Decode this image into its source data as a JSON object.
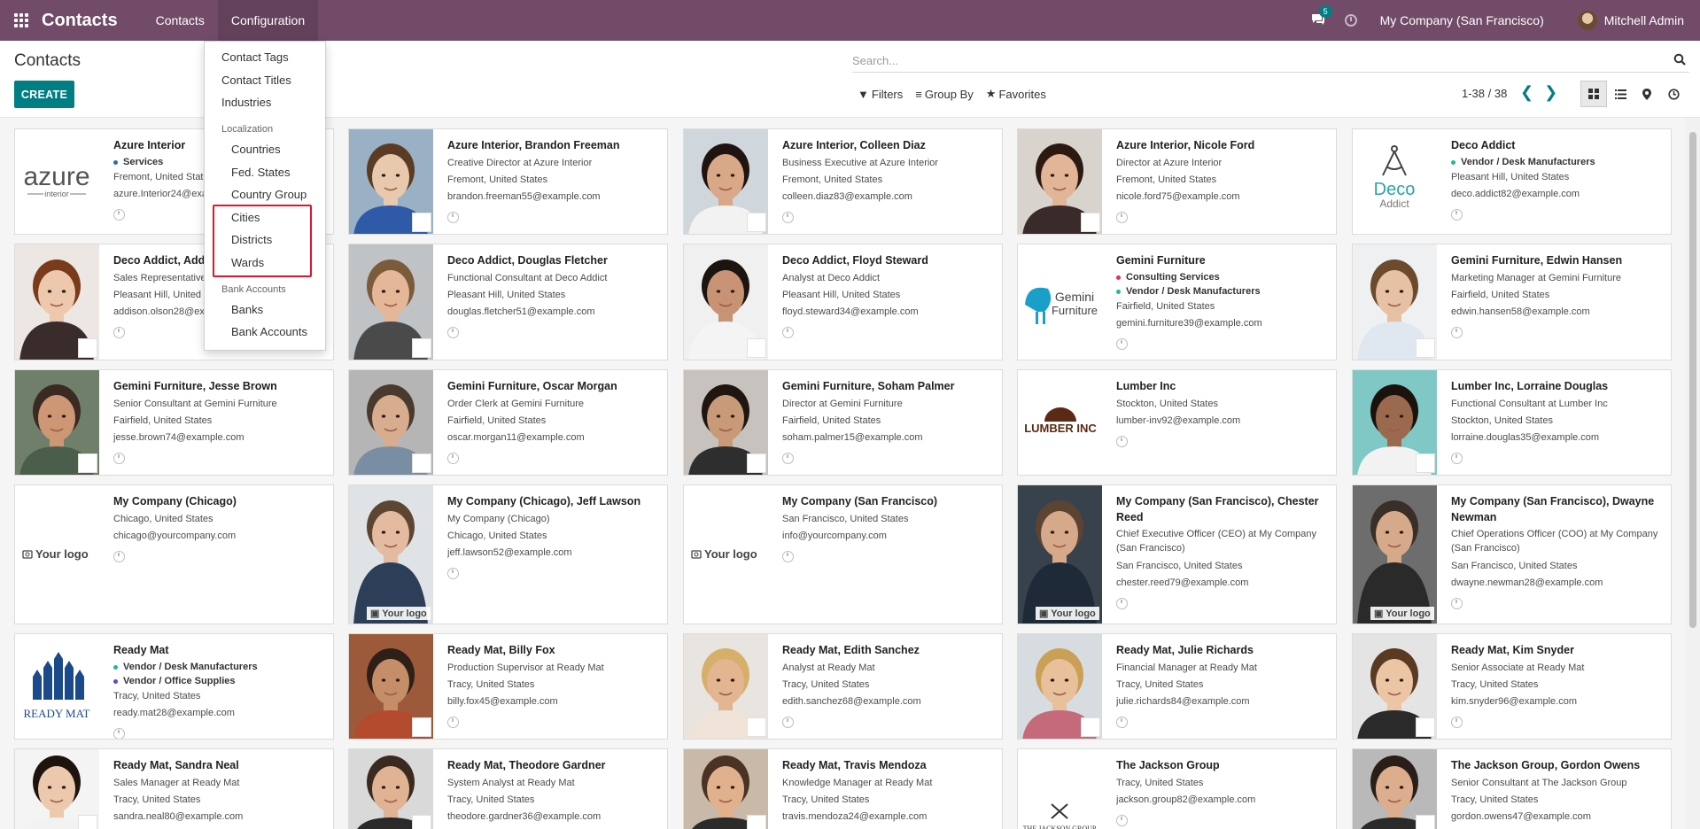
{
  "navbar": {
    "app_name": "Contacts",
    "menu": [
      "Contacts",
      "Configuration"
    ],
    "chat_count": "5",
    "company": "My Company (San Francisco)",
    "user": "Mitchell Admin"
  },
  "control_panel": {
    "title": "Contacts",
    "create_label": "CREATE",
    "search_placeholder": "Search...",
    "filters_label": "Filters",
    "groupby_label": "Group By",
    "favorites_label": "Favorites",
    "pager": "1-38 / 38"
  },
  "dropdown": {
    "items_top": [
      "Contact Tags",
      "Contact Titles",
      "Industries"
    ],
    "localization_header": "Localization",
    "localization_items": [
      "Countries",
      "Fed. States",
      "Country Group",
      "Cities",
      "Districts",
      "Wards"
    ],
    "bank_header": "Bank Accounts",
    "bank_items": [
      "Banks",
      "Bank Accounts"
    ]
  },
  "cards": [
    {
      "name": "Azure Interior",
      "tags": [
        {
          "label": "Services",
          "color": "#2b6cb0"
        }
      ],
      "lines": [
        "Fremont, United States",
        "azure.Interior24@example.com"
      ],
      "img": "azure"
    },
    {
      "name": "Azure Interior, Brandon Freeman",
      "lines": [
        "Creative Director at Azure Interior",
        "Fremont, United States",
        "brandon.freeman55@example.com"
      ],
      "img": "photo",
      "skin": "#e9c9ae",
      "hair": "#5b3b24",
      "shirt": "#2f5aa8",
      "bg": "#9ab0c4"
    },
    {
      "name": "Azure Interior, Colleen Diaz",
      "lines": [
        "Business Executive at Azure Interior",
        "Fremont, United States",
        "colleen.diaz83@example.com"
      ],
      "img": "photo",
      "skin": "#d9a888",
      "hair": "#1f1410",
      "shirt": "#f2f2f2",
      "bg": "#cfd6dc"
    },
    {
      "name": "Azure Interior, Nicole Ford",
      "lines": [
        "Director at Azure Interior",
        "Fremont, United States",
        "nicole.ford75@example.com"
      ],
      "img": "photo",
      "skin": "#e1b596",
      "hair": "#2c1a12",
      "shirt": "#3b2a2a",
      "bg": "#d8d3cd"
    },
    {
      "name": "Deco Addict",
      "tags": [
        {
          "label": "Vendor / Desk Manufacturers",
          "color": "#21b799"
        }
      ],
      "lines": [
        "Pleasant Hill, United States",
        "deco.addict82@example.com"
      ],
      "img": "deco"
    },
    {
      "name": "Deco Addict, Addison Olson",
      "lines": [
        "Sales Representative at Deco Addict",
        "Pleasant Hill, United States",
        "addison.olson28@example.com"
      ],
      "img": "photo",
      "skin": "#eec8ad",
      "hair": "#7a3a1c",
      "shirt": "#3b2c2c",
      "bg": "#ece7e2"
    },
    {
      "name": "Deco Addict, Douglas Fletcher",
      "lines": [
        "Functional Consultant at Deco Addict",
        "Pleasant Hill, United States",
        "douglas.fletcher51@example.com"
      ],
      "img": "photo",
      "skin": "#e3b798",
      "hair": "#7c5a3c",
      "shirt": "#4a4a4a",
      "bg": "#bfc3c6"
    },
    {
      "name": "Deco Addict, Floyd Steward",
      "lines": [
        "Analyst at Deco Addict",
        "Pleasant Hill, United States",
        "floyd.steward34@example.com"
      ],
      "img": "photo",
      "skin": "#c89274",
      "hair": "#1b1410",
      "shirt": "#f4f4f4",
      "bg": "#f0f0f0"
    },
    {
      "name": "Gemini Furniture",
      "tags": [
        {
          "label": "Consulting Services",
          "color": "#d9345d"
        },
        {
          "label": "Vendor / Desk Manufacturers",
          "color": "#21b799"
        }
      ],
      "lines": [
        "Fairfield, United States",
        "gemini.furniture39@example.com"
      ],
      "img": "gemini"
    },
    {
      "name": "Gemini Furniture, Edwin Hansen",
      "lines": [
        "Marketing Manager at Gemini Furniture",
        "Fairfield, United States",
        "edwin.hansen58@example.com"
      ],
      "img": "photo",
      "skin": "#e7c1a3",
      "hair": "#6c4a2c",
      "shirt": "#dfe7f0",
      "bg": "#eef0f2"
    },
    {
      "name": "Gemini Furniture, Jesse Brown",
      "lines": [
        "Senior Consultant at Gemini Furniture",
        "Fairfield, United States",
        "jesse.brown74@example.com"
      ],
      "img": "photo",
      "skin": "#cd9674",
      "hair": "#3a2a22",
      "shirt": "#4b5d4b",
      "bg": "#6f7f6a"
    },
    {
      "name": "Gemini Furniture, Oscar Morgan",
      "lines": [
        "Order Clerk at Gemini Furniture",
        "Fairfield, United States",
        "oscar.morgan11@example.com"
      ],
      "img": "photo",
      "skin": "#d8ad8f",
      "hair": "#4a3a2e",
      "shirt": "#7a8ea3",
      "bg": "#b5b5b5"
    },
    {
      "name": "Gemini Furniture, Soham Palmer",
      "lines": [
        "Director at Gemini Furniture",
        "Fairfield, United States",
        "soham.palmer15@example.com"
      ],
      "img": "photo",
      "skin": "#c89a7a",
      "hair": "#1f1612",
      "shirt": "#2e2e2e",
      "bg": "#c7c2bd"
    },
    {
      "name": "Lumber Inc",
      "lines": [
        "Stockton, United States",
        "lumber-inv92@example.com"
      ],
      "img": "lumber"
    },
    {
      "name": "Lumber Inc, Lorraine Douglas",
      "lines": [
        "Functional Consultant at Lumber Inc",
        "Stockton, United States",
        "lorraine.douglas35@example.com"
      ],
      "img": "photo",
      "skin": "#9b6a4e",
      "hair": "#1b120e",
      "shirt": "#f2f2f2",
      "bg": "#7fc8c6"
    },
    {
      "name": "My Company (Chicago)",
      "lines": [
        "Chicago, United States",
        "chicago@yourcompany.com"
      ],
      "img": "yourlogo"
    },
    {
      "name": "My Company (Chicago), Jeff Lawson",
      "lines": [
        "My Company (Chicago)",
        "Chicago, United States",
        "jeff.lawson52@example.com"
      ],
      "img": "photo",
      "skin": "#e4bba0",
      "hair": "#5c4632",
      "shirt": "#2c3e58",
      "bg": "#dfe3e6",
      "yl": true
    },
    {
      "name": "My Company (San Francisco)",
      "lines": [
        "San Francisco, United States",
        "info@yourcompany.com"
      ],
      "img": "yourlogo"
    },
    {
      "name": "My Company (San Francisco), Chester Reed",
      "lines": [
        "Chief Executive Officer (CEO) at My Company (San Francisco)",
        "San Francisco, United States",
        "chester.reed79@example.com"
      ],
      "img": "photo",
      "skin": "#d6a98a",
      "hair": "#5d4432",
      "shirt": "#1e2a38",
      "bg": "#38424c",
      "yl": true,
      "wrapFirst": true
    },
    {
      "name": "My Company (San Francisco), Dwayne Newman",
      "lines": [
        "Chief Operations Officer (COO) at My Company (San Francisco)",
        "San Francisco, United States",
        "dwayne.newman28@example.com"
      ],
      "img": "photo",
      "skin": "#d6a98a",
      "hair": "#3a2e28",
      "shirt": "#2a2a2a",
      "bg": "#6d6d6d",
      "yl": true,
      "wrapFirst": true
    },
    {
      "name": "Ready Mat",
      "tags": [
        {
          "label": "Vendor / Desk Manufacturers",
          "color": "#21b799"
        },
        {
          "label": "Vendor / Office Supplies",
          "color": "#6f42c1"
        }
      ],
      "lines": [
        "Tracy, United States",
        "ready.mat28@example.com"
      ],
      "img": "readymat"
    },
    {
      "name": "Ready Mat, Billy Fox",
      "lines": [
        "Production Supervisor at Ready Mat",
        "Tracy, United States",
        "billy.fox45@example.com"
      ],
      "img": "photo",
      "skin": "#c58e68",
      "hair": "#2e2018",
      "shirt": "#b44a2e",
      "bg": "#9d5a3a"
    },
    {
      "name": "Ready Mat, Edith Sanchez",
      "lines": [
        "Analyst at Ready Mat",
        "Tracy, United States",
        "edith.sanchez68@example.com"
      ],
      "img": "photo",
      "skin": "#e3b590",
      "hair": "#d6b06a",
      "shirt": "#f0e4d8",
      "bg": "#e8e4e0"
    },
    {
      "name": "Ready Mat, Julie Richards",
      "lines": [
        "Financial Manager at Ready Mat",
        "Tracy, United States",
        "julie.richards84@example.com"
      ],
      "img": "photo",
      "skin": "#e8c09c",
      "hair": "#caa056",
      "shirt": "#c46a7a",
      "bg": "#d7dce0"
    },
    {
      "name": "Ready Mat, Kim Snyder",
      "lines": [
        "Senior Associate at Ready Mat",
        "Tracy, United States",
        "kim.snyder96@example.com"
      ],
      "img": "photo",
      "skin": "#ecc5a5",
      "hair": "#5a3a22",
      "shirt": "#2a2a2a",
      "bg": "#e4e4e4"
    },
    {
      "name": "Ready Mat, Sandra Neal",
      "lines": [
        "Sales Manager at Ready Mat",
        "Tracy, United States",
        "sandra.neal80@example.com"
      ],
      "img": "photo",
      "skin": "#ecc9ac",
      "hair": "#1d1410",
      "shirt": "#f2f2f2",
      "bg": "#f4f4f4"
    },
    {
      "name": "Ready Mat, Theodore Gardner",
      "lines": [
        "System Analyst at Ready Mat",
        "Tracy, United States",
        "theodore.gardner36@example.com"
      ],
      "img": "photo",
      "skin": "#e0b394",
      "hair": "#3a2a20",
      "shirt": "#2a2a2a",
      "bg": "#d9d9d9"
    },
    {
      "name": "Ready Mat, Travis Mendoza",
      "lines": [
        "Knowledge Manager at Ready Mat",
        "Tracy, United States",
        "travis.mendoza24@example.com"
      ],
      "img": "photo",
      "skin": "#e1b08c",
      "hair": "#4a3324",
      "shirt": "#2b2b2b",
      "bg": "#c9b9a8"
    },
    {
      "name": "The Jackson Group",
      "lines": [
        "Tracy, United States",
        "jackson.group82@example.com"
      ],
      "img": "jackson"
    },
    {
      "name": "The Jackson Group, Gordon Owens",
      "lines": [
        "Senior Consultant at The Jackson Group",
        "Tracy, United States",
        "gordon.owens47@example.com"
      ],
      "img": "photo",
      "skin": "#dcae8d",
      "hair": "#2a1f18",
      "shirt": "#2a2a2a",
      "bg": "#b9b9b9"
    }
  ]
}
